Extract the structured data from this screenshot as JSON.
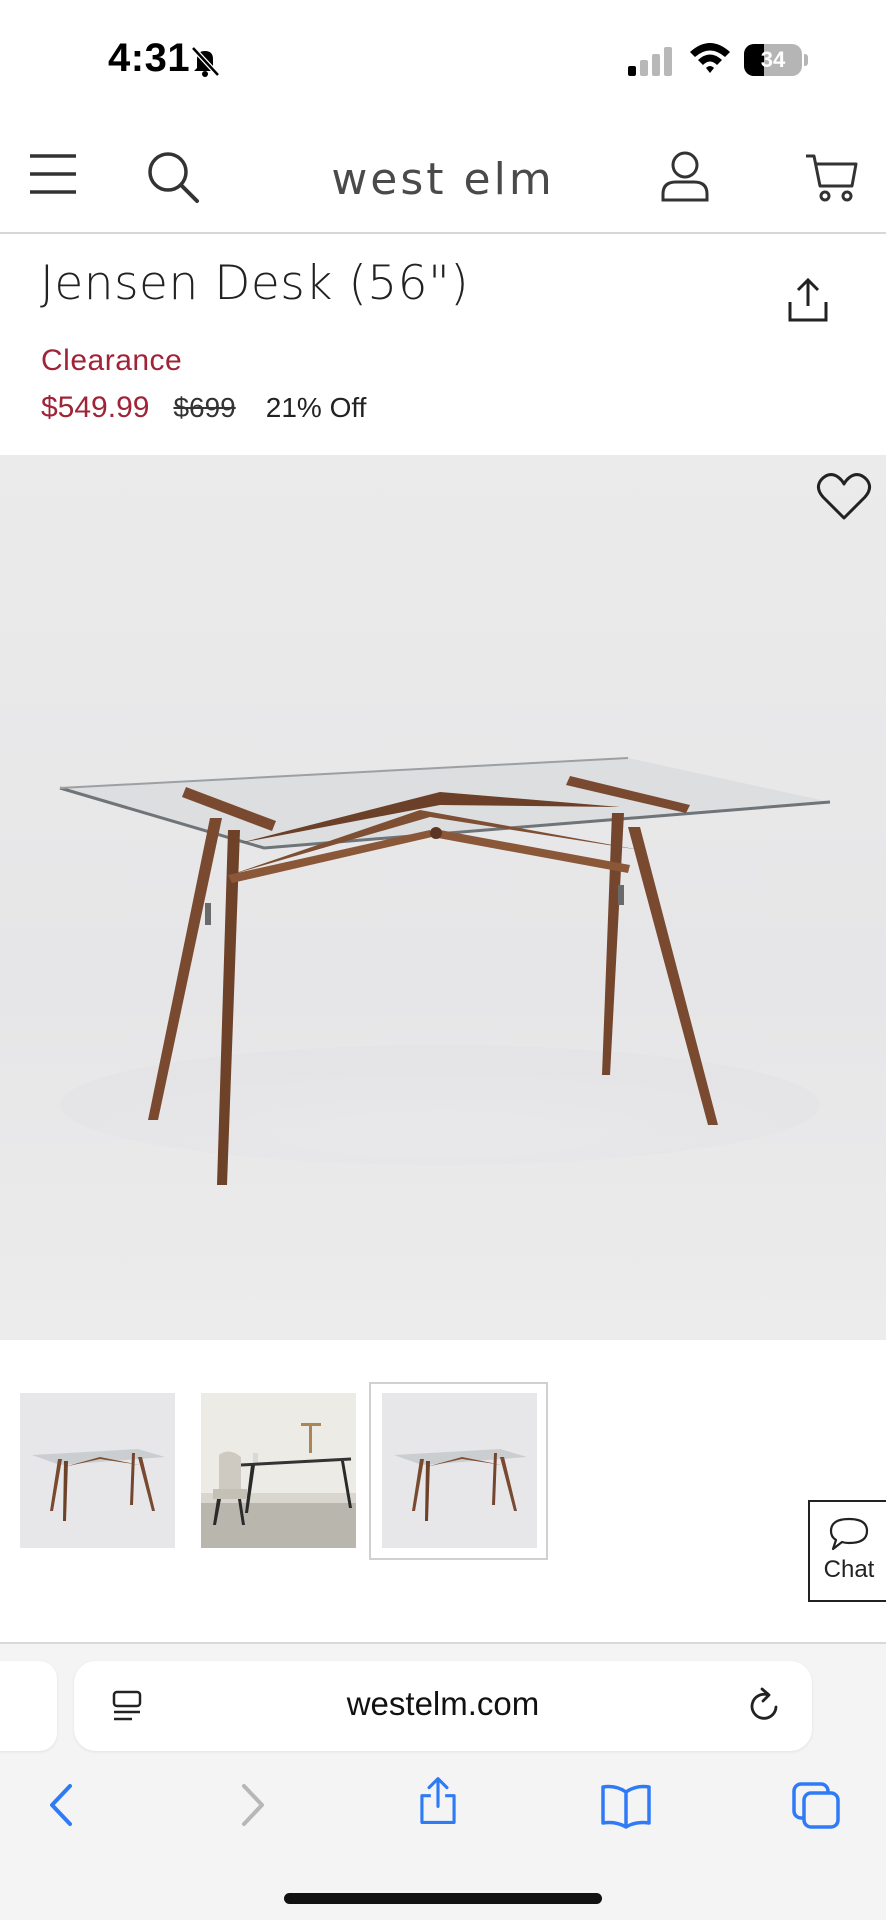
{
  "status_bar": {
    "time": "4:31",
    "battery_level": "34",
    "battery_fraction": 0.34
  },
  "header": {
    "logo": "west elm",
    "icons": [
      "menu-icon",
      "search-icon",
      "account-icon",
      "cart-icon"
    ]
  },
  "product": {
    "title": "Jensen Desk (56\")",
    "badge": "Clearance",
    "sale_price": "$549.99",
    "original_price": "$699",
    "discount": "21% Off"
  },
  "gallery": {
    "thumbnail_count": 3,
    "selected_index": 2
  },
  "chat": {
    "label": "Chat"
  },
  "browser": {
    "url": "westelm.com",
    "toolbar_icons": [
      "back-icon",
      "forward-icon",
      "share-icon",
      "bookmarks-icon",
      "tabs-icon"
    ]
  },
  "colors": {
    "accent_red": "#a02438",
    "safari_blue": "#2f7bf6",
    "wood": "#7a4a30",
    "glass": "#6f7478"
  }
}
